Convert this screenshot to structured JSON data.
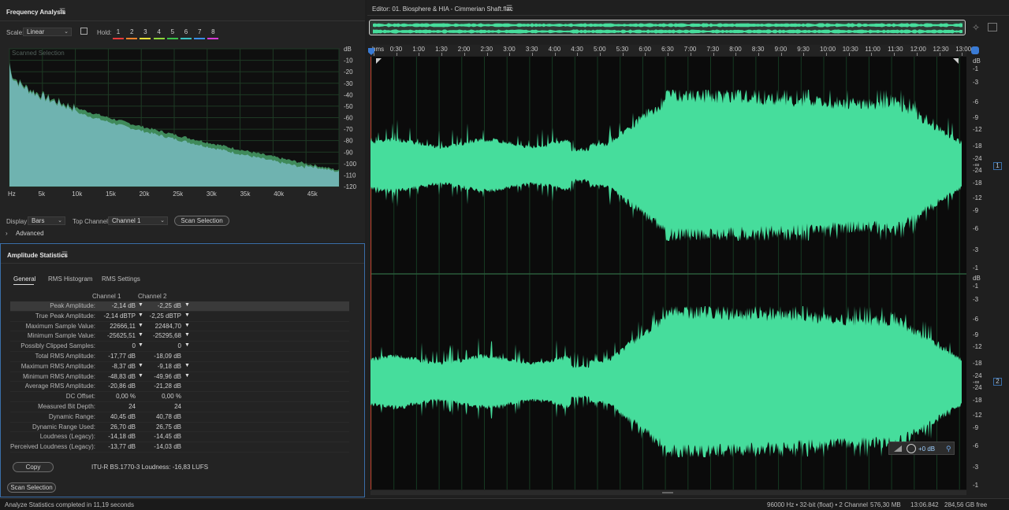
{
  "freq_panel": {
    "title": "Frequency Analysis",
    "scale_label": "Scale:",
    "scale_value": "Linear",
    "hold_label": "Hold:",
    "hold_buttons": [
      {
        "label": "1",
        "color": "#e83a3a"
      },
      {
        "label": "2",
        "color": "#f0822a"
      },
      {
        "label": "3",
        "color": "#e8e23a"
      },
      {
        "label": "4",
        "color": "#8fd63a"
      },
      {
        "label": "5",
        "color": "#3ac24a"
      },
      {
        "label": "6",
        "color": "#3ac2c2"
      },
      {
        "label": "7",
        "color": "#3a8fe8"
      },
      {
        "label": "8",
        "color": "#d63ad6"
      }
    ],
    "graph_caption": "Scanned Selection",
    "db_labels": [
      "dB",
      "-10",
      "-20",
      "-30",
      "-40",
      "-50",
      "-60",
      "-70",
      "-80",
      "-90",
      "-100",
      "-110",
      "-120"
    ],
    "hz_labels": [
      "Hz",
      "5k",
      "10k",
      "15k",
      "20k",
      "25k",
      "30k",
      "35k",
      "40k",
      "45k"
    ],
    "display_label": "Display:",
    "display_value": "Bars",
    "top_channel_label": "Top Channel:",
    "top_channel_value": "Channel 1",
    "scan_button": "Scan Selection",
    "advanced_label": "Advanced"
  },
  "amp_panel": {
    "title": "Amplitude Statistics",
    "tabs": [
      "General",
      "RMS Histogram",
      "RMS Settings"
    ],
    "col_headers": [
      "Channel 1",
      "Channel 2"
    ],
    "rows": [
      {
        "name": "Peak Amplitude:",
        "v1": "-2,14 dB",
        "v2": "-2,25 dB",
        "pin": true
      },
      {
        "name": "True Peak Amplitude:",
        "v1": "-2,14 dBTP",
        "v2": "-2,25 dBTP",
        "pin": true
      },
      {
        "name": "Maximum Sample Value:",
        "v1": "22666,11",
        "v2": "22484,70",
        "pin": true
      },
      {
        "name": "Minimum Sample Value:",
        "v1": "-25625,51",
        "v2": "-25295,68",
        "pin": true
      },
      {
        "name": "Possibly Clipped Samples:",
        "v1": "0",
        "v2": "0",
        "pin": true
      },
      {
        "name": "Total RMS Amplitude:",
        "v1": "-17,77 dB",
        "v2": "-18,09 dB",
        "pin": false
      },
      {
        "name": "Maximum RMS Amplitude:",
        "v1": "-8,37 dB",
        "v2": "-9,18 dB",
        "pin": true
      },
      {
        "name": "Minimum RMS Amplitude:",
        "v1": "-48,83 dB",
        "v2": "-49,96 dB",
        "pin": true
      },
      {
        "name": "Average RMS Amplitude:",
        "v1": "-20,86 dB",
        "v2": "-21,28 dB",
        "pin": false
      },
      {
        "name": "DC Offset:",
        "v1": "0,00 %",
        "v2": "0,00 %",
        "pin": false
      },
      {
        "name": "Measured Bit Depth:",
        "v1": "24",
        "v2": "24",
        "pin": false
      },
      {
        "name": "Dynamic Range:",
        "v1": "40,45 dB",
        "v2": "40,78 dB",
        "pin": false
      },
      {
        "name": "Dynamic Range Used:",
        "v1": "26,70 dB",
        "v2": "26,75 dB",
        "pin": false
      },
      {
        "name": "Loudness (Legacy):",
        "v1": "-14,18 dB",
        "v2": "-14,45 dB",
        "pin": false
      },
      {
        "name": "Perceived Loudness (Legacy):",
        "v1": "-13,77 dB",
        "v2": "-14,03 dB",
        "pin": false
      }
    ],
    "copy_button": "Copy",
    "itu_text": "ITU-R BS.1770-3 Loudness: -16,83 LUFS",
    "scan_button": "Scan Selection"
  },
  "editor": {
    "title": "Editor: 01. Biosphere & HIA - Cimmerian Shaft.flac",
    "time_labels": [
      "hms",
      "0:30",
      "1:00",
      "1:30",
      "2:00",
      "2:30",
      "3:00",
      "3:30",
      "4:00",
      "4:30",
      "5:00",
      "5:30",
      "6:00",
      "6:30",
      "7:00",
      "7:30",
      "8:00",
      "8:30",
      "9:00",
      "9:30",
      "10:00",
      "10:30",
      "11:00",
      "11:30",
      "12:00",
      "12:30",
      "13:00"
    ],
    "db_scale_top": [
      "dB",
      "-1",
      "-3",
      "-6",
      "-9",
      "-12",
      "-18",
      "-24",
      "-∞",
      "-24",
      "-18",
      "-12",
      "-9",
      "-6",
      "-3",
      "-1"
    ],
    "db_scale_bottom": [
      "dB",
      "-1",
      "-3",
      "-6",
      "-9",
      "-12",
      "-18",
      "-24",
      "-∞",
      "-24",
      "-18",
      "-12",
      "-9",
      "-6",
      "-3",
      "-1"
    ],
    "channel_1": "1",
    "channel_2": "2",
    "gain_readout": "+0 dB",
    "wave_color": "#46dd9c"
  },
  "status_bar": {
    "left": "Analyze Statistics completed in 11,19 seconds",
    "format": "96000 Hz • 32-bit (float) • 2 Channel",
    "size": "576,30 MB",
    "duration": "13:06.842",
    "free": "284,56 GB free"
  }
}
